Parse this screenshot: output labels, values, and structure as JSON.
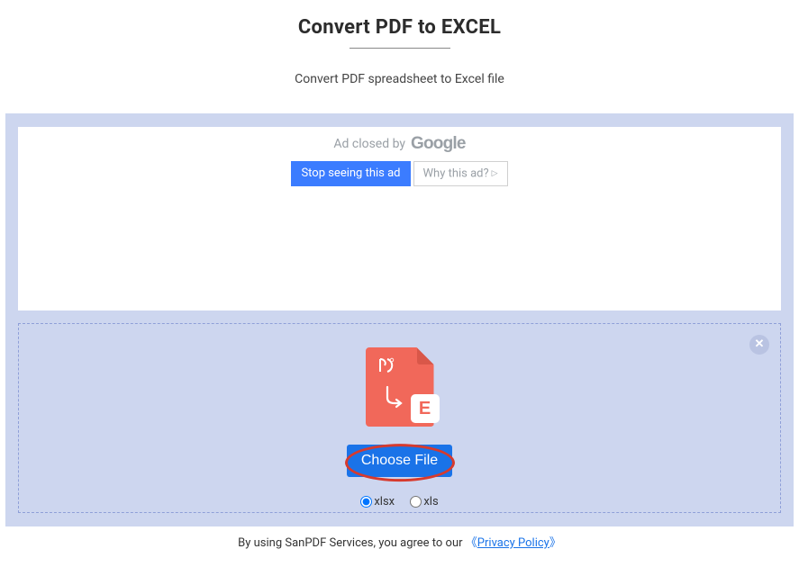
{
  "header": {
    "title": "Convert PDF to EXCEL",
    "subtitle": "Convert PDF spreadsheet to Excel file"
  },
  "ad": {
    "closed_by_text": "Ad closed by",
    "google_label": "Google",
    "stop_seeing_label": "Stop seeing this ad",
    "why_ad_label": "Why this ad?"
  },
  "dropzone": {
    "choose_file_label": "Choose File",
    "e_badge": "E",
    "option_xlsx": "xlsx",
    "option_xls": "xls"
  },
  "footer": {
    "agree_prefix": "By using SanPDF Services, you agree to our ",
    "bracket_open": "《",
    "privacy_link": "Privacy Policy",
    "bracket_close": "》"
  }
}
